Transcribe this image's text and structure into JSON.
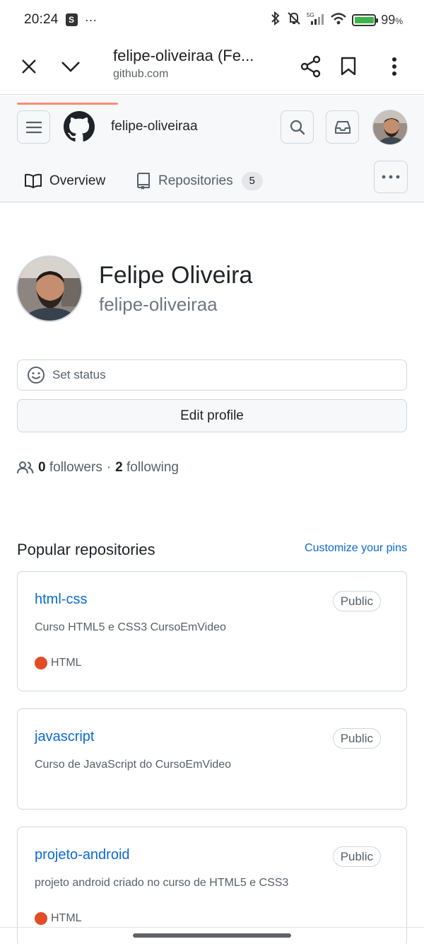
{
  "status_bar": {
    "time": "20:24",
    "battery": "99",
    "battery_unit": "%",
    "network": "5G"
  },
  "browser": {
    "title": "felipe-oliveiraa (Fe...",
    "url": "github.com"
  },
  "header": {
    "username": "felipe-oliveiraa"
  },
  "tabs": [
    {
      "label": "Overview",
      "selected": true
    },
    {
      "label": "Repositories",
      "count": "5"
    }
  ],
  "profile": {
    "name": "Felipe Oliveira",
    "login": "felipe-oliveiraa",
    "set_status": "Set status",
    "edit_profile": "Edit profile",
    "followers_count": "0",
    "followers_label": "followers",
    "separator": "·",
    "following_count": "2",
    "following_label": "following"
  },
  "popular": {
    "title": "Popular repositories",
    "customize": "Customize your pins",
    "repos": [
      {
        "name": "html-css",
        "visibility": "Public",
        "description": "Curso HTML5 e CSS3 CursoEmVideo",
        "language": "HTML"
      },
      {
        "name": "javascript",
        "visibility": "Public",
        "description": "Curso de JavaScript do CursoEmVideo"
      },
      {
        "name": "projeto-android",
        "visibility": "Public",
        "description": "projeto android criado no curso de HTML5 e CSS3",
        "language": "HTML"
      }
    ]
  },
  "colors": {
    "link": "#0969da",
    "tab_underline": "#fd8c73",
    "html_language": "#e34c26"
  }
}
